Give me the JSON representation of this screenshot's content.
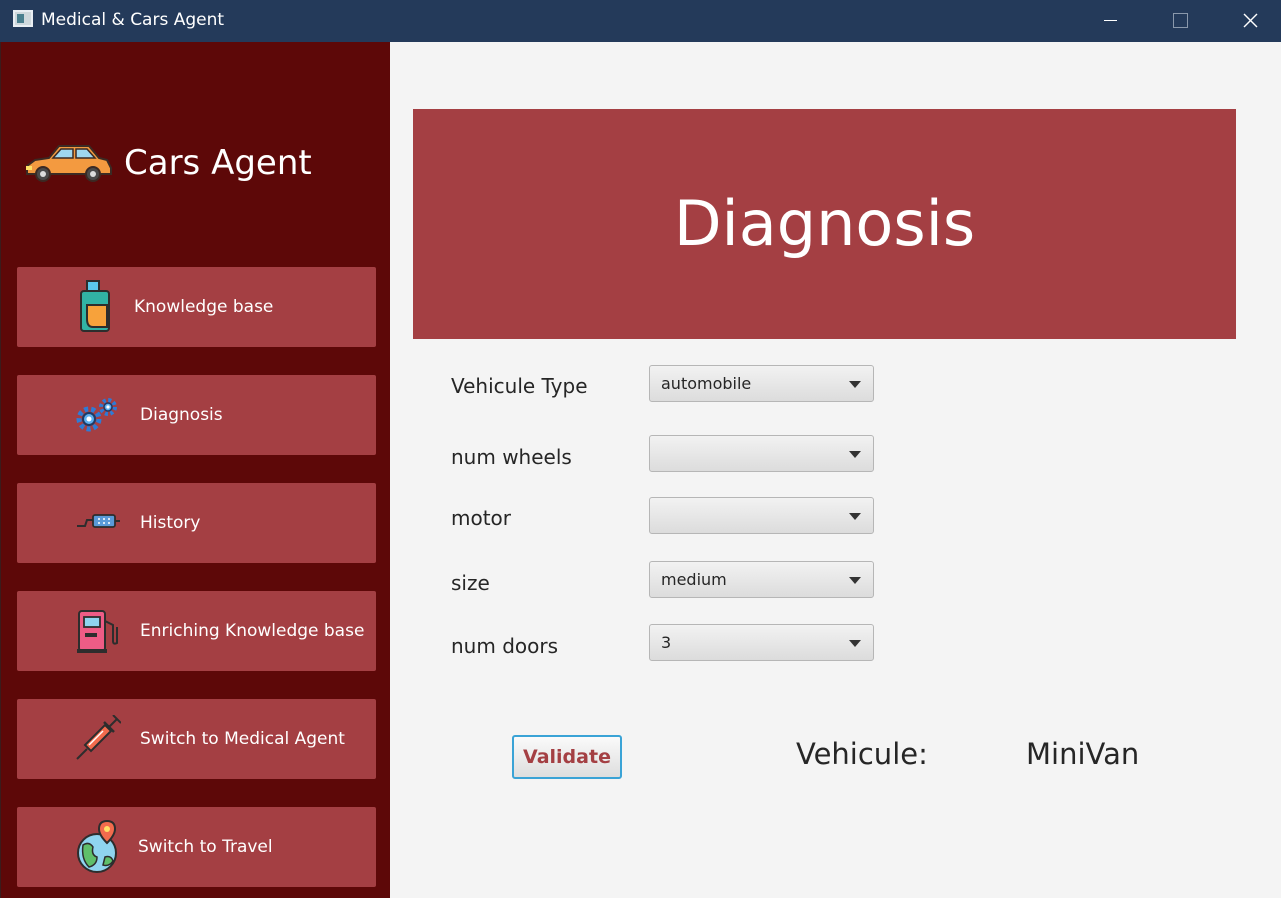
{
  "window": {
    "title": "Medical & Cars Agent"
  },
  "sidebar": {
    "brand": {
      "label": "Cars Agent",
      "icon": "car-icon"
    },
    "items": [
      {
        "label": "Knowledge base",
        "icon": "oil-can-icon"
      },
      {
        "label": "Diagnosis",
        "icon": "gears-icon"
      },
      {
        "label": "History",
        "icon": "exhaust-pipe-icon"
      },
      {
        "label": "Enriching Knowledge base",
        "icon": "fuel-pump-icon"
      },
      {
        "label": "Switch to Medical Agent",
        "icon": "syringe-icon"
      },
      {
        "label": "Switch to Travel",
        "icon": "globe-pin-icon"
      }
    ]
  },
  "main": {
    "banner_title": "Diagnosis",
    "form": {
      "fields": [
        {
          "label": "Vehicule Type",
          "value": "automobile"
        },
        {
          "label": "num wheels",
          "value": ""
        },
        {
          "label": "motor",
          "value": ""
        },
        {
          "label": "size",
          "value": "medium"
        },
        {
          "label": "num doors",
          "value": "3"
        }
      ]
    },
    "validate_label": "Validate",
    "result": {
      "label": "Vehicule:",
      "value": "MiniVan"
    }
  },
  "colors": {
    "titlebar": "#243a5a",
    "sidebar": "#5d0808",
    "accent": "#a43f43",
    "content_bg": "#f4f4f4",
    "focus_border": "#3aa3d6"
  }
}
